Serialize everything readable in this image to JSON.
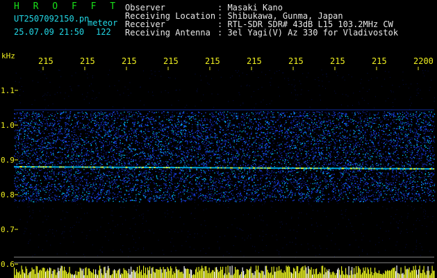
{
  "header": {
    "app_title": "H R O F F T",
    "filename": "UT2507092150.pn",
    "meteor_label": "meteor",
    "datetime": "25.07.09 21:50",
    "meteor_count": "122",
    "info": [
      {
        "label": "Observer",
        "value": ": Masaki Kano"
      },
      {
        "label": "Receiving Location",
        "value": ": Shibukawa, Gunma, Japan"
      },
      {
        "label": "Receiver",
        "value": ": RTL-SDR SDR# 43dB L15 103.2MHz CW"
      },
      {
        "label": "Receiving Antenna",
        "value": ": 3el Yagi(V) Az 330 for Vladivostok"
      }
    ]
  },
  "chart_data": {
    "type": "heatmap",
    "y_unit_label": "kHz",
    "y_ticks": [
      "1.1",
      "1.0",
      "0.9",
      "0.8",
      "0.7",
      "0.6"
    ],
    "x_ticks": [
      "215",
      "215",
      "215",
      "215",
      "215",
      "215",
      "215",
      "215",
      "215",
      "2200"
    ],
    "ylim": [
      0.6,
      1.1
    ],
    "signal_band_khz": [
      0.78,
      1.04
    ],
    "carrier_line_khz": 0.88
  },
  "colors": {
    "background": "#000000",
    "label_green": "#19e019",
    "label_cyan": "#22d8e6",
    "tick_yellow": "#f0f020",
    "noise_dark": "#0a1a8a",
    "noise_mid": "#1d48ff",
    "noise_high": "#00c8ff",
    "signal_yellow": "#e8f020"
  }
}
